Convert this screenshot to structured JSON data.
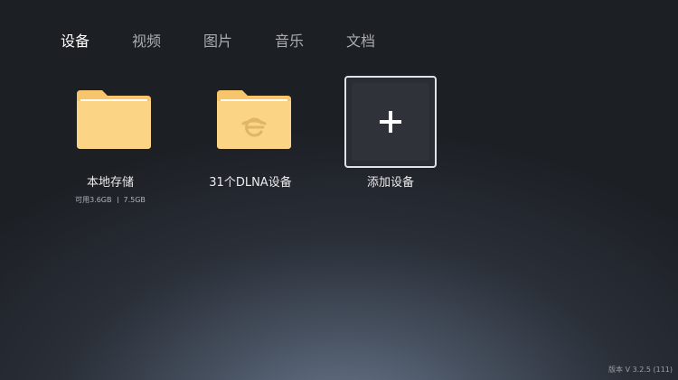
{
  "tabs": [
    {
      "label": "设备",
      "active": true
    },
    {
      "label": "视频",
      "active": false
    },
    {
      "label": "图片",
      "active": false
    },
    {
      "label": "音乐",
      "active": false
    },
    {
      "label": "文档",
      "active": false
    }
  ],
  "devices": [
    {
      "label": "本地存储",
      "icon": "folder-icon",
      "used": "可用3.6GB",
      "total": "7.5GB"
    },
    {
      "label": "31个DLNA设备",
      "icon": "dlna-folder-icon"
    },
    {
      "label": "添加设备",
      "icon": "plus-icon"
    }
  ],
  "version": "版本 V 3.2.5 (111)",
  "colors": {
    "folder": "#fbd486",
    "folder_tab": "#f6c56c",
    "accent_text": "#ffffff",
    "inactive_text": "#a8acb2"
  }
}
